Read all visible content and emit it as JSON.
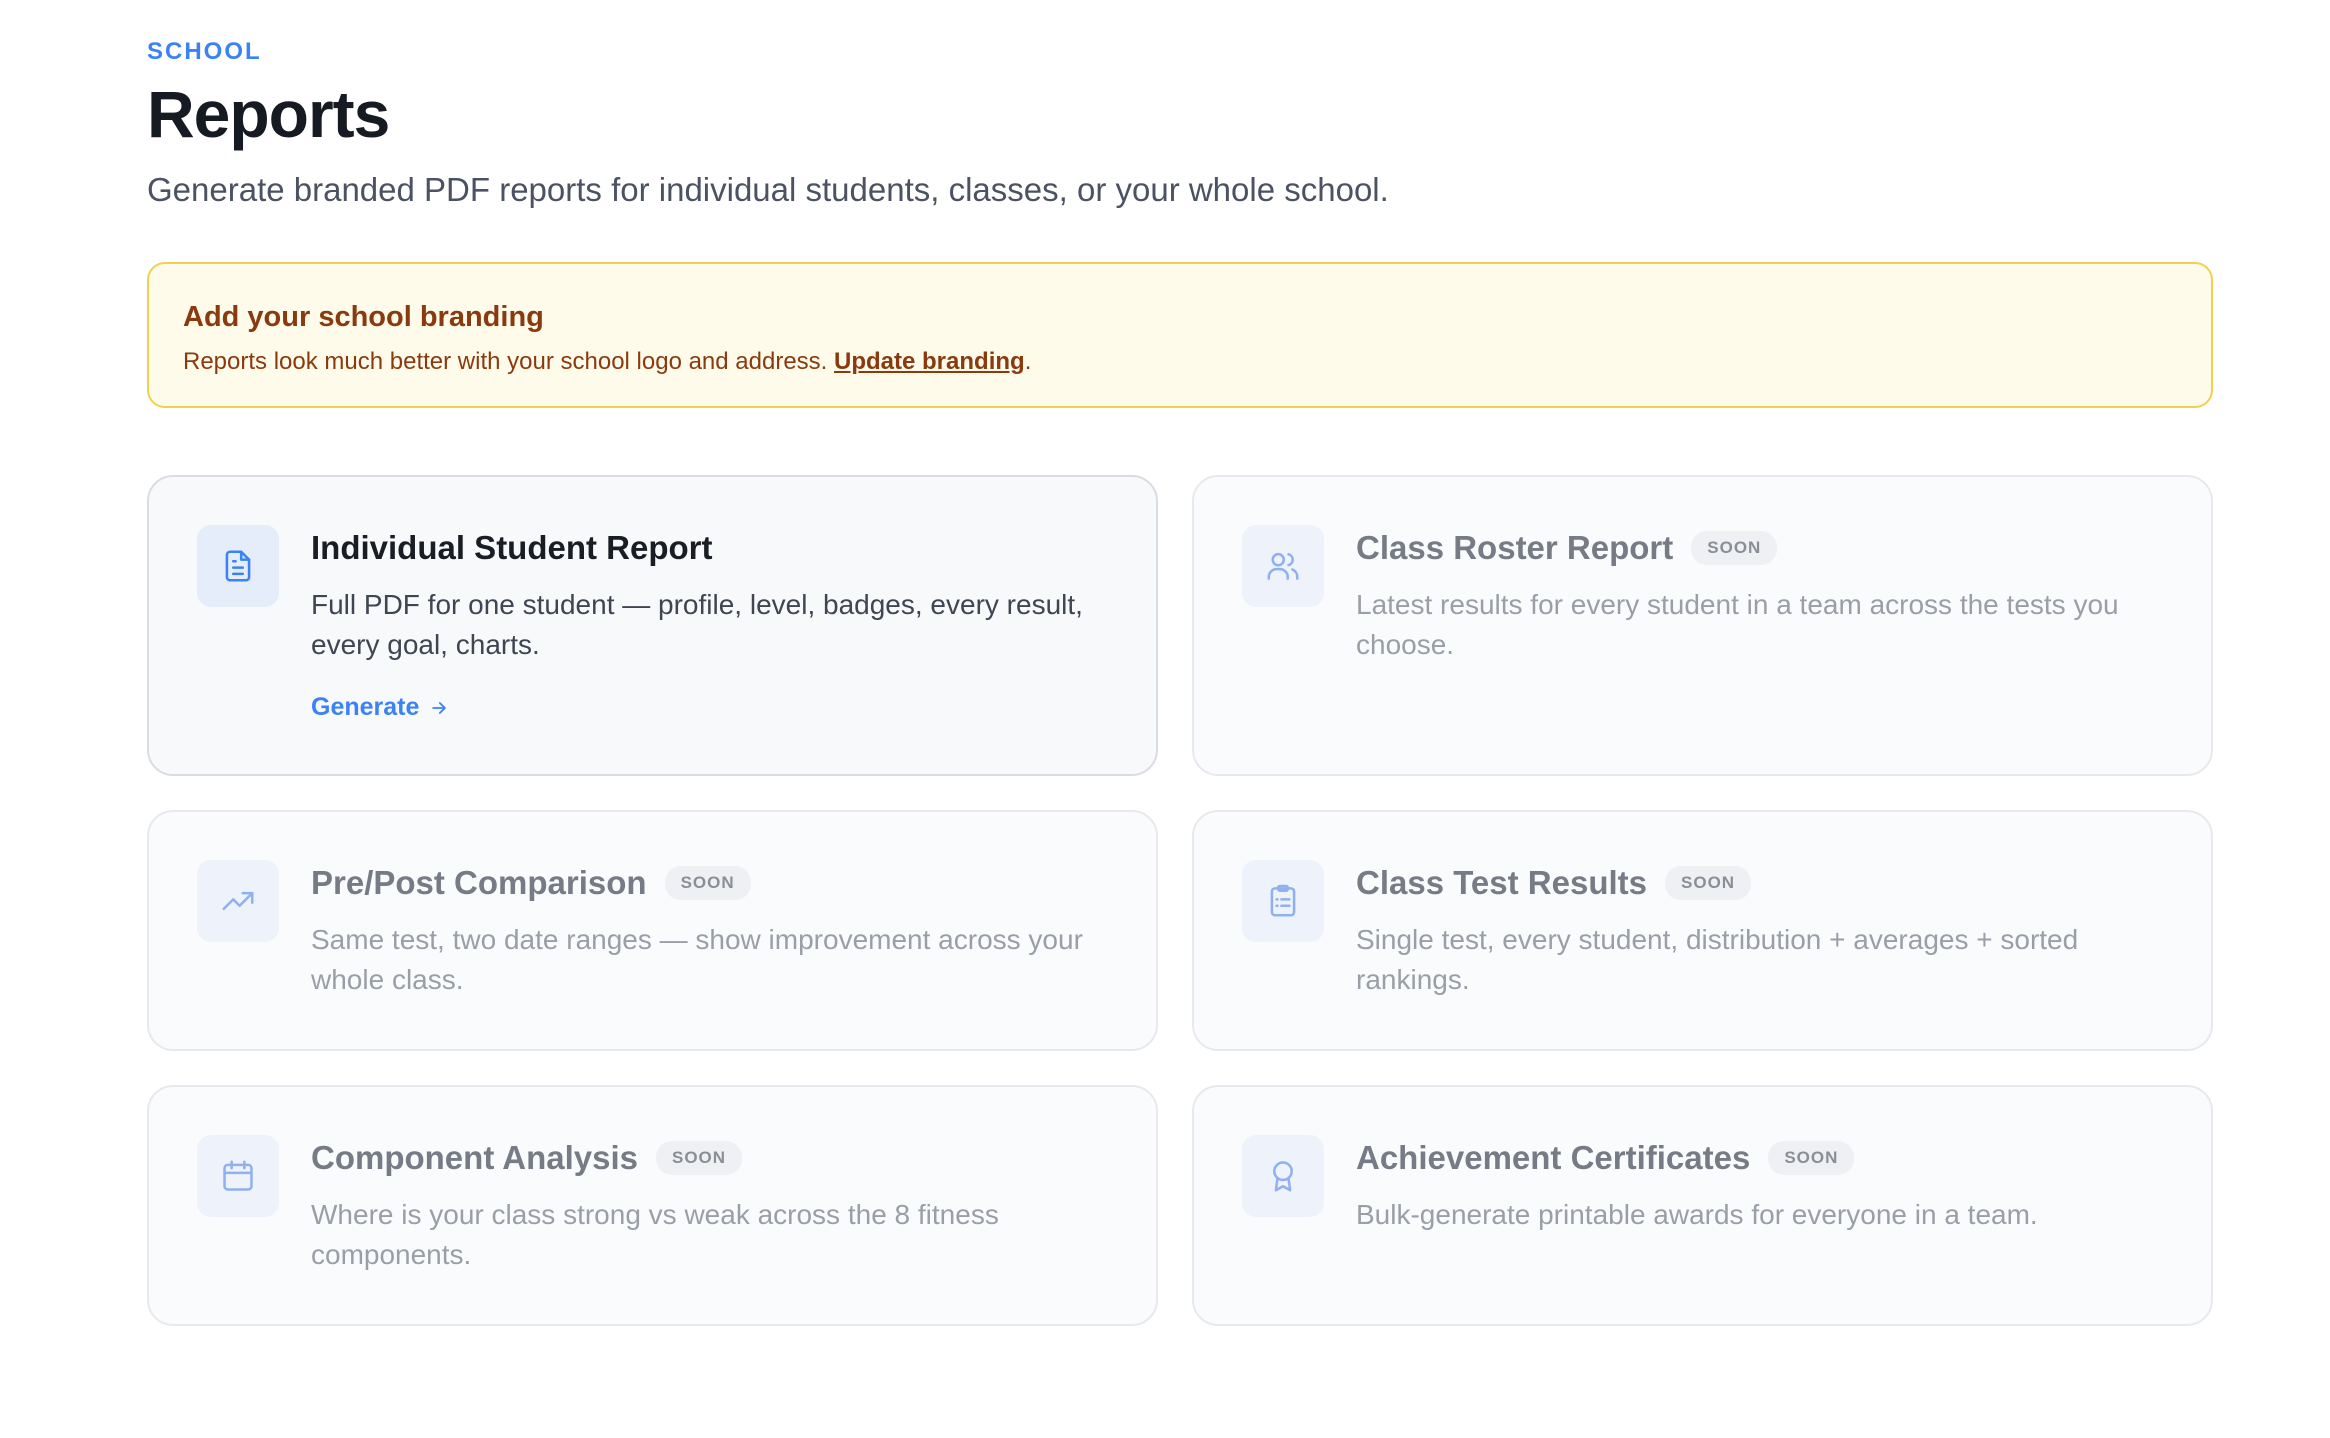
{
  "header": {
    "eyebrow": "SCHOOL",
    "title": "Reports",
    "subtitle": "Generate branded PDF reports for individual students, classes, or your whole school."
  },
  "banner": {
    "title": "Add your school branding",
    "text": "Reports look much better with your school logo and address.",
    "link_label": "Update branding",
    "trailing": "."
  },
  "cards": [
    {
      "title": "Individual Student Report",
      "description": "Full PDF for one student — profile, level, badges, every result, every goal, charts.",
      "action_label": "Generate",
      "icon": "document-icon"
    },
    {
      "title": "Class Roster Report",
      "badge": "SOON",
      "description": "Latest results for every student in a team across the tests you choose.",
      "icon": "users-icon"
    },
    {
      "title": "Pre/Post Comparison",
      "badge": "SOON",
      "description": "Same test, two date ranges — show improvement across your whole class.",
      "icon": "trending-up-icon"
    },
    {
      "title": "Class Test Results",
      "badge": "SOON",
      "description": "Single test, every student, distribution + averages + sorted rankings.",
      "icon": "clipboard-list-icon"
    },
    {
      "title": "Component Analysis",
      "badge": "SOON",
      "description": "Where is your class strong vs weak across the 8 fitness components.",
      "icon": "calendar-icon"
    },
    {
      "title": "Achievement Certificates",
      "badge": "SOON",
      "description": "Bulk-generate printable awards for everyone in a team.",
      "icon": "award-icon"
    }
  ],
  "colors": {
    "accent": "#3b82f6",
    "banner_bg": "#fefbea",
    "banner_border": "#f4cf4e",
    "banner_text": "#8a3a0f"
  }
}
